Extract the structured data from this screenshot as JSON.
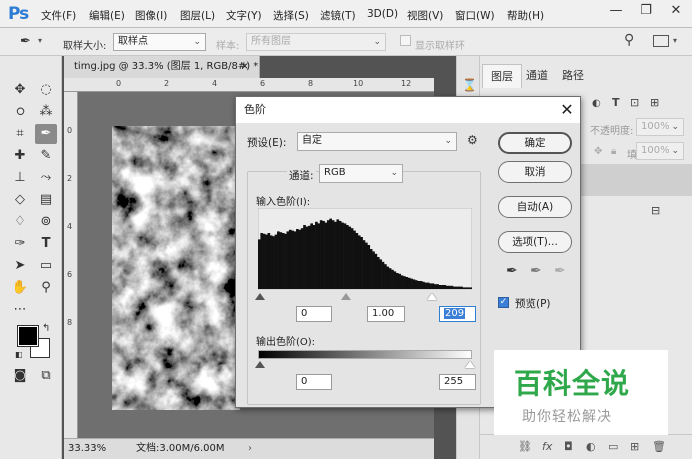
{
  "app": {
    "logo": "Ps"
  },
  "menu": [
    "文件(F)",
    "编辑(E)",
    "图像(I)",
    "图层(L)",
    "文字(Y)",
    "选择(S)",
    "滤镜(T)",
    "3D(D)",
    "视图(V)",
    "窗口(W)",
    "帮助(H)"
  ],
  "window_controls": {
    "minimize": "—",
    "restore": "❐",
    "close": "✕"
  },
  "options_bar": {
    "sample_size_label": "取样大小:",
    "sample_size_value": "取样点",
    "sample_label": "样本:",
    "sample_value": "所有图层",
    "show_ring_label": "显示取样环"
  },
  "document": {
    "tab_title": "timg.jpg @ 33.3% (图层 1, RGB/8#) *",
    "tab_close": "×",
    "zoom": "33.33%",
    "doc_info": "文档:3.00M/6.00M",
    "ruler_ticks": [
      "0",
      "2",
      "4",
      "6",
      "8",
      "10",
      "12",
      "14"
    ],
    "ruler_v_ticks": [
      "0",
      "2",
      "4",
      "6",
      "8"
    ]
  },
  "layers_panel": {
    "tabs": [
      "图层",
      "通道",
      "路径"
    ],
    "opacity_label": "不透明度:",
    "opacity_value": "100%",
    "fill_label": "填充:",
    "fill_value": "100%"
  },
  "levels_dialog": {
    "title": "色阶",
    "close": "✕",
    "preset_label": "预设(E):",
    "preset_value": "自定",
    "channel_label": "通道:",
    "channel_value": "RGB",
    "input_levels_label": "输入色阶(I):",
    "input_black": "0",
    "input_gamma": "1.00",
    "input_white": "209",
    "output_levels_label": "输出色阶(O):",
    "output_black": "0",
    "output_white": "255",
    "buttons": {
      "ok": "确定",
      "cancel": "取消",
      "auto": "自动(A)",
      "options": "选项(T)..."
    },
    "preview_label": "预览(P)",
    "preview_checked": true,
    "histogram": [
      0.62,
      0.7,
      0.69,
      0.68,
      0.7,
      0.67,
      0.66,
      0.68,
      0.72,
      0.71,
      0.7,
      0.69,
      0.72,
      0.74,
      0.73,
      0.72,
      0.75,
      0.74,
      0.76,
      0.8,
      0.78,
      0.79,
      0.82,
      0.8,
      0.84,
      0.82,
      0.86,
      0.85,
      0.83,
      0.86,
      0.88,
      0.86,
      0.84,
      0.87,
      0.85,
      0.83,
      0.82,
      0.8,
      0.78,
      0.76,
      0.73,
      0.7,
      0.67,
      0.65,
      0.61,
      0.58,
      0.55,
      0.5,
      0.47,
      0.44,
      0.4,
      0.37,
      0.34,
      0.31,
      0.28,
      0.26,
      0.24,
      0.22,
      0.2,
      0.19,
      0.17,
      0.16,
      0.15,
      0.14,
      0.13,
      0.12,
      0.11,
      0.1,
      0.1,
      0.09,
      0.08,
      0.08,
      0.07,
      0.07,
      0.06,
      0.06,
      0.05,
      0.05,
      0.05,
      0.04,
      0.04,
      0.04,
      0.03,
      0.03,
      0.03,
      0.03,
      0.02,
      0.02,
      0.02,
      0.02
    ]
  },
  "watermark": {
    "title": "百科全说",
    "subtitle": "助你轻松解决",
    "title_color": "#2ea84a"
  }
}
